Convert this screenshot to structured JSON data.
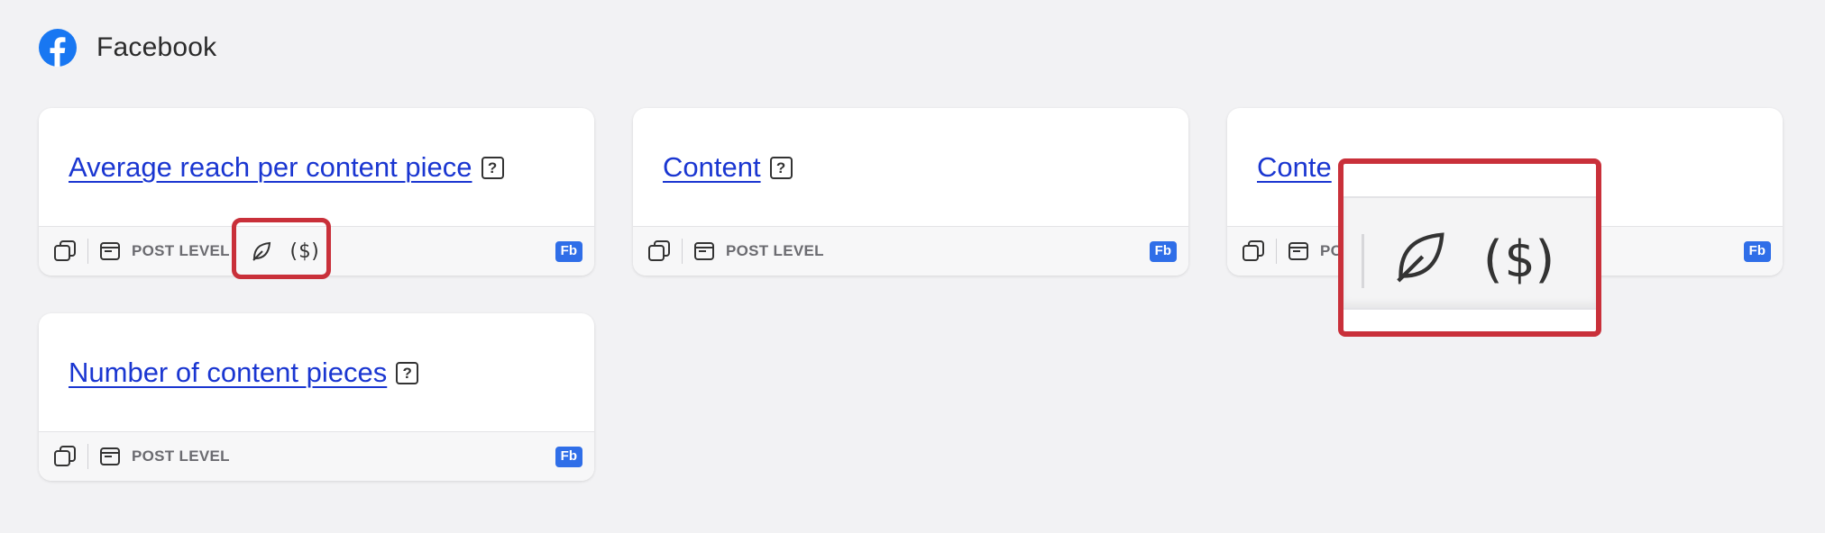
{
  "header": {
    "title": "Facebook",
    "icon": "facebook-logo-icon",
    "brand_color": "#1877f2"
  },
  "cards": [
    {
      "title": "Average reach per content piece",
      "level": "POST LEVEL",
      "badge": "Fb",
      "extra_icons": [
        "leaf-icon",
        "dollar-brackets-icon"
      ],
      "extra_dollar": "($)"
    },
    {
      "title": "Content",
      "level": "POST LEVEL",
      "badge": "Fb"
    },
    {
      "title": "Content interactions",
      "title_visible": "Conte",
      "level": "POST LEVEL",
      "level_visible": "PO",
      "badge": "Fb"
    },
    {
      "title": "Number of content pieces",
      "level": "POST LEVEL",
      "badge": "Fb"
    }
  ],
  "help_glyph": "?",
  "zoom": {
    "dollar": "($)",
    "icons": [
      "leaf-icon",
      "dollar-brackets-icon"
    ]
  },
  "colors": {
    "link": "#1a36d1",
    "badge": "#2f6ee8",
    "highlight": "#c9303a"
  }
}
